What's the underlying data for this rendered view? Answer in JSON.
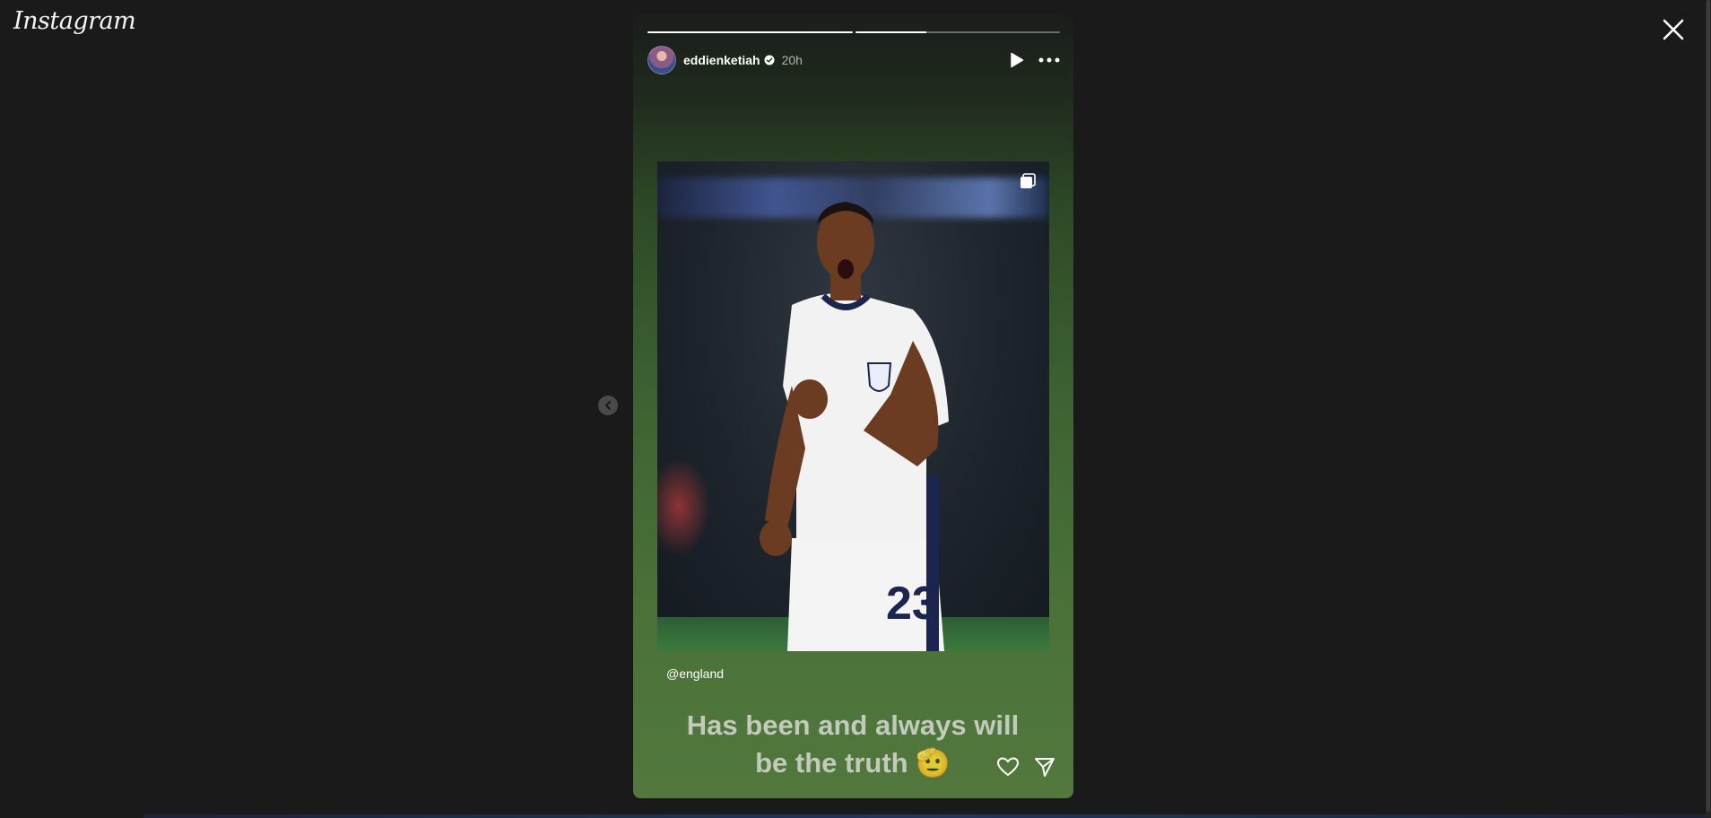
{
  "app": {
    "logo_text": "Instagram"
  },
  "window": {
    "close_icon": "close-icon",
    "prev_icon": "chevron-left-icon"
  },
  "story": {
    "progress": [
      1.0,
      0.35
    ],
    "user": {
      "username": "eddienketiah",
      "verified": true,
      "time_ago": "20h"
    },
    "header_icons": [
      "play-icon",
      "more-options-icon"
    ],
    "photo_icon": "multiple-media-icon",
    "mention": "@england",
    "caption_line1": "Has been and always will",
    "caption_line2": "be the truth",
    "caption_emoji": "🫡",
    "footer_icons": [
      "heart-icon",
      "share-icon"
    ]
  },
  "colors": {
    "background": "#1a1a1a",
    "story_gradient_bottom": "#52783e",
    "text": "#ffffff"
  }
}
